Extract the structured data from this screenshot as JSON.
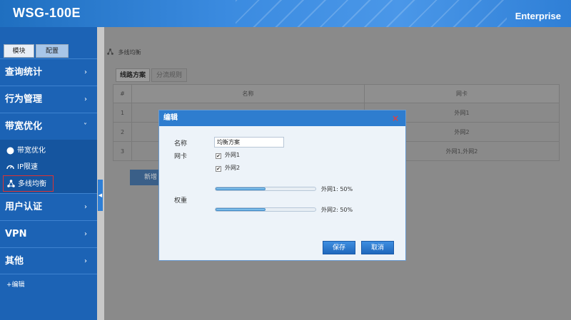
{
  "header": {
    "title": "WSG-100E",
    "edition": "Enterprise"
  },
  "sidebar": {
    "tabs": [
      "模块",
      "配置"
    ],
    "nav": [
      {
        "label": "查询统计",
        "chevron": "›"
      },
      {
        "label": "行为管理",
        "chevron": "›"
      },
      {
        "label": "带宽优化",
        "chevron": "˅"
      },
      {
        "label": "用户认证",
        "chevron": "›"
      },
      {
        "label": "VPN",
        "chevron": "›"
      },
      {
        "label": "其他",
        "chevron": "›"
      }
    ],
    "sub_items": [
      {
        "label": "带宽优化",
        "icon": "circle-icon"
      },
      {
        "label": "IP限速",
        "icon": "speedometer-icon"
      },
      {
        "label": "多线均衡",
        "icon": "network-icon"
      }
    ],
    "edit_link": "+编辑"
  },
  "main": {
    "breadcrumb": "多线均衡",
    "tabs": [
      "线路方案",
      "分流规则"
    ],
    "table": {
      "headers": [
        "#",
        "名称",
        "网卡"
      ],
      "rows": [
        {
          "idx": "1",
          "name": "",
          "nic": "外网1"
        },
        {
          "idx": "2",
          "name": "",
          "nic": "外网2"
        },
        {
          "idx": "3",
          "name": "",
          "nic": "外网1,外网2"
        }
      ]
    },
    "add_button": "新增"
  },
  "dialog": {
    "title": "编辑",
    "close": "×",
    "name_label": "名称",
    "name_value": "均衡方案",
    "nic_label": "网卡",
    "nic_options": [
      {
        "label": "外网1",
        "checked": true
      },
      {
        "label": "外网2",
        "checked": true
      }
    ],
    "weight_label": "权重",
    "weights": [
      {
        "label": "外网1: 50%",
        "value": 50
      },
      {
        "label": "外网2: 50%",
        "value": 50
      }
    ],
    "save_button": "保存",
    "cancel_button": "取消"
  },
  "colors": {
    "header": "#2f7fd6",
    "sidebar": "#1c63b5",
    "dialog_head": "#2e7dcf",
    "close": "#e04040"
  }
}
